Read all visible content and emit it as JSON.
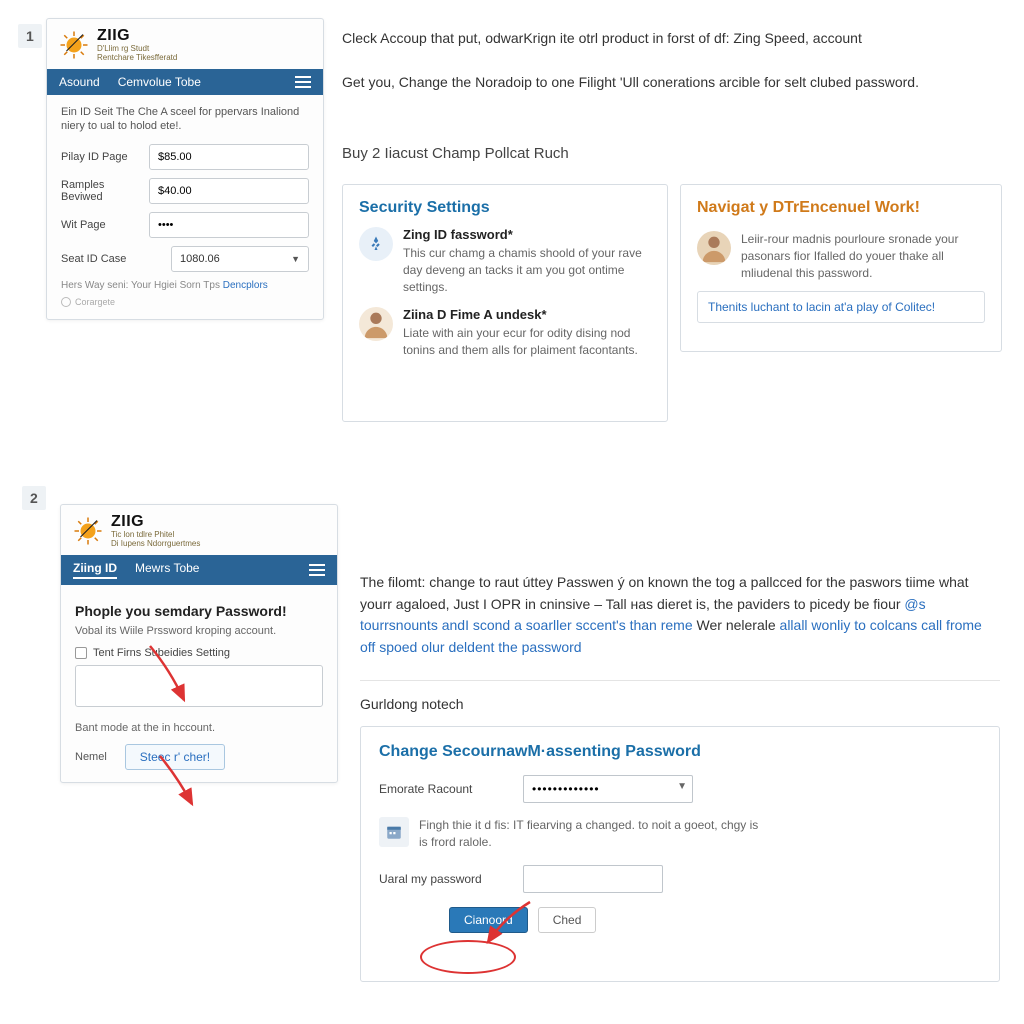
{
  "step1": {
    "num": "1",
    "panel": {
      "brand_name": "ZIIG",
      "brand_sub1": "D'Llim rg Studt",
      "brand_sub2": "Rentchare Tikesfferatd",
      "nav": {
        "left": "Asound",
        "right": "Cemvolue Tobe"
      },
      "intro": "Ein ID Seit The Che A sceel for ppervars Inaliond niery to ual to holod ete!.",
      "rows": [
        {
          "label": "Pilay ID Page",
          "value": "$85.00"
        },
        {
          "label": "Ramples Beviwed",
          "value": "$40.00"
        },
        {
          "label": "Wit Page",
          "value": "••••"
        },
        {
          "label": "Seat ID Case",
          "value": "1080.06",
          "type": "select"
        }
      ],
      "footer": "Hers Way seni: Your Hgiei Sorn Tps",
      "footer_link": "Dencplors",
      "tiny": "Corargete"
    },
    "instr1": "Cleck Accoup that put, odwarKrign ite otrl product in forst of df: Zing Speed, account",
    "instr2": "Get you, Change the Noradoip to one Filight 'Ull conerations arcible for selt clubed password.",
    "buy_head": "Buy 2 Iiacust Champ Pollcat Ruch",
    "security_card": {
      "title": "Security Settings",
      "item1_title": "Zing ID fassword*",
      "item1_desc": "This cur chamg a chamis shoold of your rave day deveng an tacks it am you got ontime settings.",
      "item2_title": "Ziina D Fime A undesk*",
      "item2_desc": "Liate with ain your ecur for odity dising nod tonins and them alls for plaiment facontants."
    },
    "nav_card": {
      "title": "Navigat y DTrEncenuel Work!",
      "desc": "Leiir-rour madnis pourloure sronade your pasonars fior Ifalled do youer thake all mliudenal this password.",
      "box": "Thenits luchant to lacin at'a play of Colitec!"
    }
  },
  "step2": {
    "num": "2",
    "panel": {
      "brand_name": "ZIIG",
      "brand_sub1": "Tic lon tdlre Phitel",
      "brand_sub2": "Di Iupens Ndorrguertmes",
      "nav": {
        "left": "Ziing ID",
        "right": "Mewrs Tobe"
      },
      "title": "Phople you semdary Password!",
      "sub": "Vobal its Wiile Prssword kroping account.",
      "checkbox": "Tent Firns Subeidies Setting",
      "note": "Bant mode at the in hccount.",
      "nemel": "Nemel",
      "btn": "Steec r' cher!"
    },
    "instr": "The filomt: change to raut úttey Passwen ý on known the tog a pallcced for the paswors tiime what yourr agaloed, Just I OPR in cninsive – Tall нas dieret is, the paviders to picedy be fiour ",
    "link1": "@s tourrsnounts andI scond a soarller sccent's than reme",
    "instr_cont": " Wer nelerale ",
    "link2": "allall wonliy to colcans call frome off spoed olur deldent the password",
    "gurl": "Gurldong notech",
    "pw_card": {
      "title": "Change SecournawM·assenting Password",
      "row1_label": "Emorate Racount",
      "row1_value": "•••••••••••••",
      "info": "Fingh thie it d fis: IT fiearving a changed. to noit a goeot, chgy is is frord ralole.",
      "row2_label": "Uaral my password",
      "btn_primary": "Cianoord",
      "btn_secondary": "Ched"
    }
  }
}
